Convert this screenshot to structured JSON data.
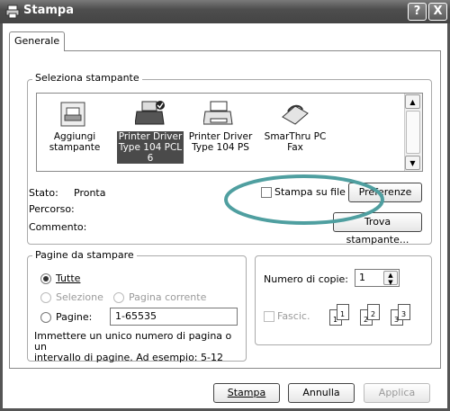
{
  "window": {
    "title": "Stampa",
    "help_button": "?",
    "close_button": "X"
  },
  "tabs": [
    {
      "label": "Generale"
    }
  ],
  "printer_section": {
    "label": "Seleziona stampante",
    "printers": [
      {
        "name": "Aggiungi\nstampante"
      },
      {
        "name": "Printer Driver\nType 104 PCL\n6"
      },
      {
        "name": "Printer Driver\nType 104 PS"
      },
      {
        "name": "SmarThru PC\nFax"
      }
    ],
    "status_label": "Stato:",
    "status_value": "Pronta",
    "path_label": "Percorso:",
    "comment_label": "Commento:",
    "print_to_file_label": "Stampa su file",
    "preferences_button": "Preferenze",
    "find_printer_button": "Trova stampante..."
  },
  "pages_section": {
    "label": "Pagine da stampare",
    "all_label": "Tutte",
    "selection_label": "Selezione",
    "current_page_label": "Pagina corrente",
    "pages_label": "Pagine:",
    "pages_value": "1-65535",
    "hint": "Immettere un unico numero di pagina o un\nintervallo di pagine. Ad esempio: 5-12"
  },
  "copies_section": {
    "copies_label": "Numero di copie:",
    "copies_value": "1",
    "collate_label": "Fascic.",
    "collate_pages": [
      "1",
      "1",
      "2",
      "2",
      "3",
      "3"
    ]
  },
  "buttons": {
    "print": "Stampa",
    "cancel": "Annulla",
    "apply": "Applica"
  },
  "colors": {
    "highlight": "#4f9fa0",
    "selection": "#4a4a4a"
  }
}
